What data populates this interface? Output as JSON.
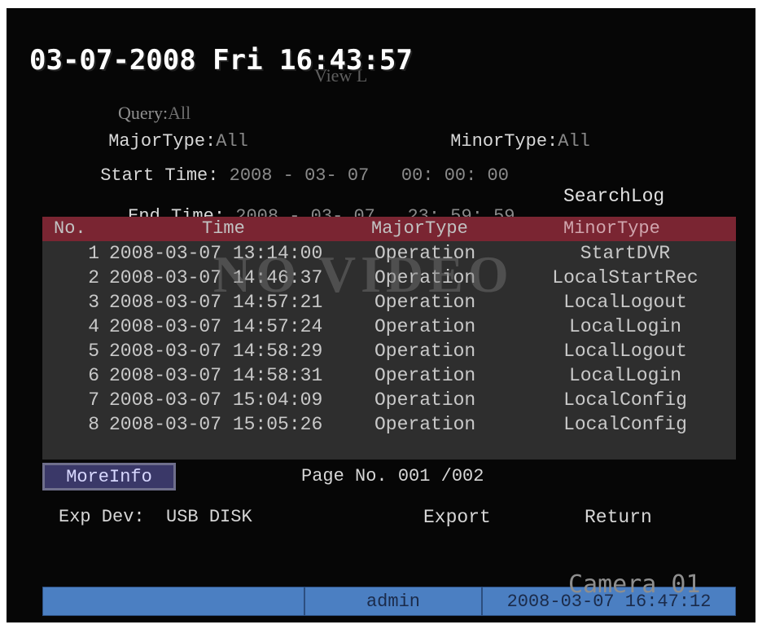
{
  "osd": {
    "datetime": "03-07-2008 Fri 16:43:57",
    "ghost_title": "View L"
  },
  "form": {
    "query_label": "Query:",
    "query_value": "All",
    "major_label": "MajorType:",
    "major_value": "All",
    "minor_label": "MinorType:",
    "minor_value": "All",
    "start_label": "Start Time:",
    "start_value": "2008 - 03- 07   00: 00: 00",
    "end_label": "End Time:",
    "end_value": "2008 - 03- 07   23: 59: 59",
    "searchlog_label": "SearchLog"
  },
  "table": {
    "headers": [
      "No.",
      "Time",
      "MajorType",
      "MinorType"
    ],
    "watermark": "NO VIDEO",
    "rows": [
      {
        "no": "1",
        "time": "2008-03-07 13:14:00",
        "major": "Operation",
        "minor": "StartDVR"
      },
      {
        "no": "2",
        "time": "2008-03-07 14:46:37",
        "major": "Operation",
        "minor": "LocalStartRec"
      },
      {
        "no": "3",
        "time": "2008-03-07 14:57:21",
        "major": "Operation",
        "minor": "LocalLogout"
      },
      {
        "no": "4",
        "time": "2008-03-07 14:57:24",
        "major": "Operation",
        "minor": "LocalLogin"
      },
      {
        "no": "5",
        "time": "2008-03-07 14:58:29",
        "major": "Operation",
        "minor": "LocalLogout"
      },
      {
        "no": "6",
        "time": "2008-03-07 14:58:31",
        "major": "Operation",
        "minor": "LocalLogin"
      },
      {
        "no": "7",
        "time": "2008-03-07 15:04:09",
        "major": "Operation",
        "minor": "LocalConfig"
      },
      {
        "no": "8",
        "time": "2008-03-07 15:05:26",
        "major": "Operation",
        "minor": "LocalConfig"
      }
    ]
  },
  "footer": {
    "moreinfo_label": "MoreInfo",
    "page_info": "Page No. 001 /002",
    "exp_dev_label": "Exp Dev:",
    "exp_dev_value": "USB DISK",
    "export_label": "Export",
    "return_label": "Return"
  },
  "camera_label": "Camera 01",
  "status_bar": {
    "user": "admin",
    "datetime": "2008-03-07 16:47:12"
  },
  "colors": {
    "header_bg": "#7a2532",
    "table_bg": "#2e2e2e",
    "status_bg": "#4b7fc2",
    "moreinfo_bg": "#3a3868"
  }
}
